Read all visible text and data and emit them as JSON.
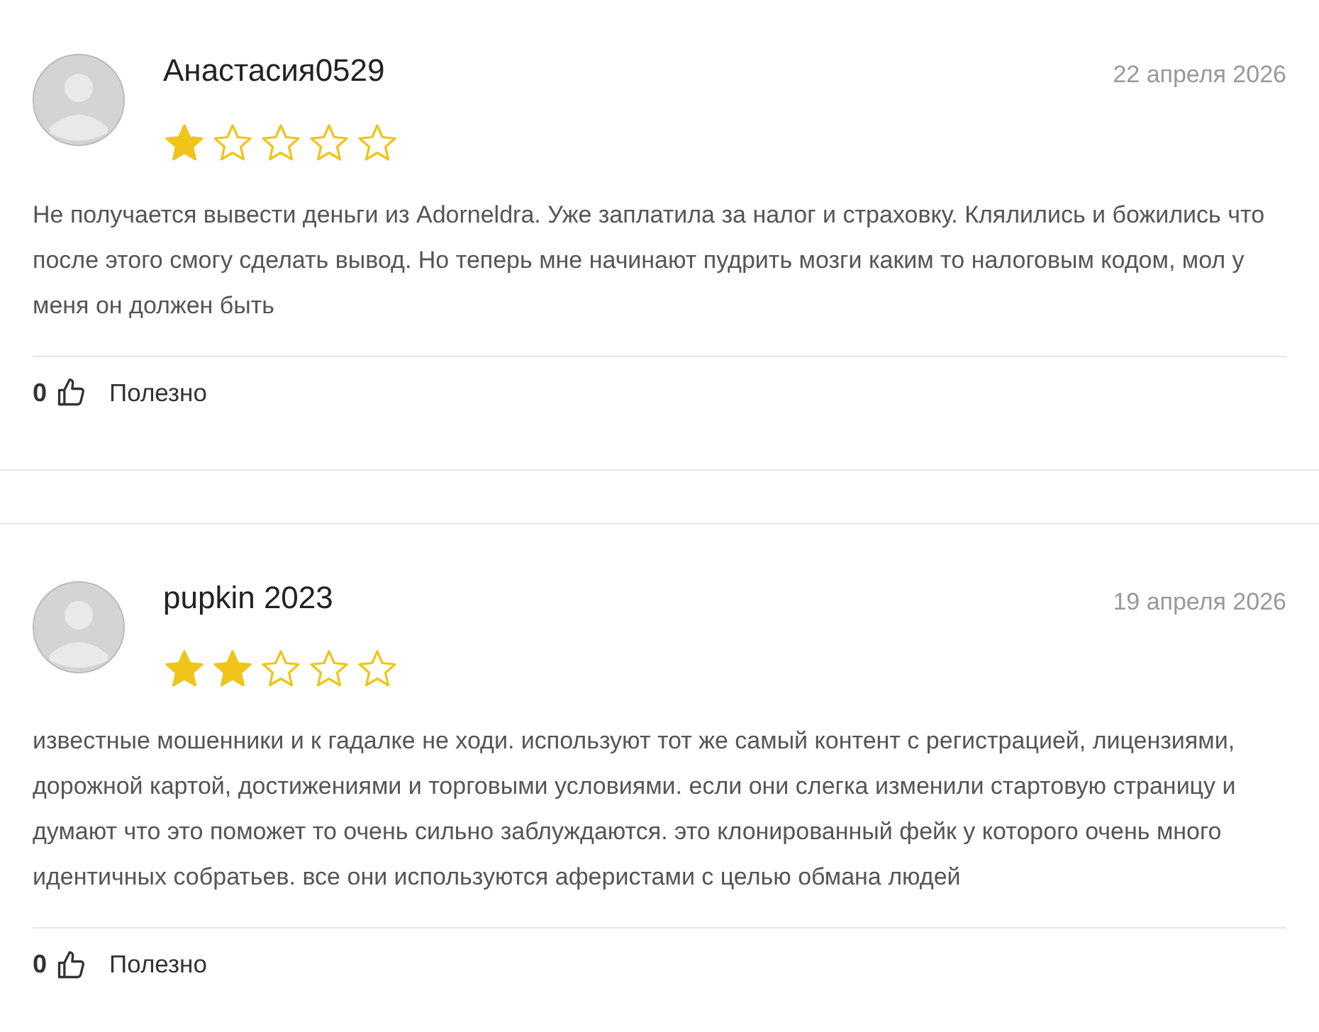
{
  "reviews": [
    {
      "author": "Анастасия0529",
      "date": "22 апреля 2026",
      "stars": 1,
      "text": "Не получается вывести деньги из Adorneldra. Уже заплатила за налог и страховку. Клялились и божились что после этого смогу сделать вывод. Но теперь мне начинают пудрить мозги каким то налоговым кодом, мол у меня он должен быть",
      "likes": "0",
      "helpful_label": "Полезно"
    },
    {
      "author": "pupkin 2023",
      "date": "19 апреля 2026",
      "stars": 2,
      "text": "известные мошенники и к гадалке не ходи. используют тот же самый контент с регистрацией, лицензиями, дорожной картой, достижениями и торговыми условиями. если они слегка изменили стартовую страницу и думают что это поможет то очень сильно заблуждаются. это клонированный фейк у которого очень много идентичных собратьев. все они используются аферистами с целью обмана людей",
      "likes": "0",
      "helpful_label": "Полезно"
    }
  ]
}
